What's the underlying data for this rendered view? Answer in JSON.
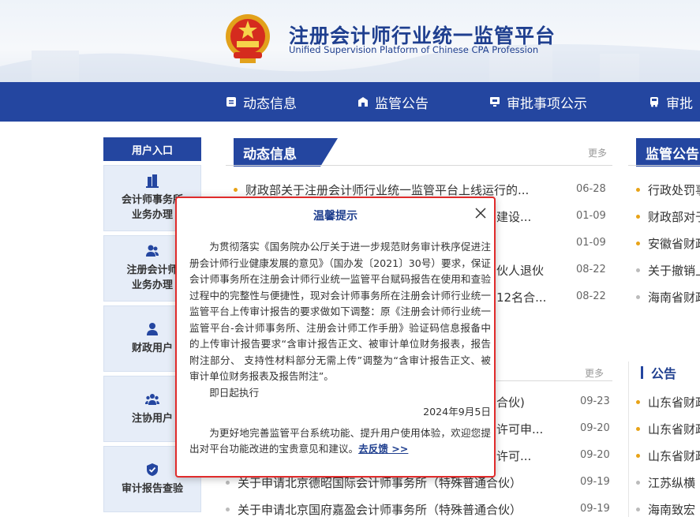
{
  "header": {
    "title_cn": "注册会计师行业统一监管平台",
    "title_en": "Unified Supervision Platform of Chinese CPA Profession"
  },
  "nav": {
    "items": [
      {
        "label": "动态信息",
        "icon": "document-icon"
      },
      {
        "label": "监管公告",
        "icon": "building-icon"
      },
      {
        "label": "审批事项公示",
        "icon": "monitor-icon"
      },
      {
        "label": "审批",
        "icon": "bus-icon"
      }
    ]
  },
  "sidebar": {
    "title": "用户入口",
    "items": [
      {
        "label": "会计师事务所\n业务办理",
        "icon": "building-icon"
      },
      {
        "label": "注册会计师\n业务办理",
        "icon": "users-icon"
      },
      {
        "label": "财政用户",
        "icon": "user-icon"
      },
      {
        "label": "注协用户",
        "icon": "group-icon"
      },
      {
        "label": "审计报告查验",
        "icon": "shield-check-icon"
      }
    ]
  },
  "news": {
    "title": "动态信息",
    "more": "更多",
    "rows": [
      {
        "text": "财政部关于注册会计师行业统一监管平台上线运行的...",
        "date": "06-28"
      },
      {
        "text": "建设...",
        "date": "01-09"
      },
      {
        "text": "",
        "date": "01-09"
      },
      {
        "text": "伙人退伙",
        "date": "08-22"
      },
      {
        "text": "12名合...",
        "date": "08-22"
      }
    ]
  },
  "approval": {
    "more": "更多",
    "rows": [
      {
        "text": "合伙)",
        "date": "09-23"
      },
      {
        "text": "许可申...",
        "date": "09-20"
      },
      {
        "text": "许可...",
        "date": "09-20"
      },
      {
        "text": "关于申请北京德昭国际会计师事务所（特殊普通合伙）",
        "date": "09-19"
      },
      {
        "text": "关于申请北京国府嘉盈会计师事务所（特殊普通合伙）",
        "date": "09-19"
      }
    ]
  },
  "supervision": {
    "title": "监管公告",
    "rows": [
      {
        "text": "行政处罚事"
      },
      {
        "text": "财政部对于"
      },
      {
        "text": "安徽省财政"
      },
      {
        "text": "关于撤销上"
      },
      {
        "text": "海南省财政"
      }
    ],
    "sub_title": "公告",
    "sub_rows": [
      {
        "text": "山东省财政"
      },
      {
        "text": "山东省财政"
      },
      {
        "text": "山东省财政"
      },
      {
        "text": "江苏纵横"
      },
      {
        "text": "海南致宏"
      }
    ]
  },
  "modal": {
    "title": "温馨提示",
    "paragraph1": "为贯彻落实《国务院办公厅关于进一步规范财务审计秩序促进注册会计师行业健康发展的意见》（国办发〔2021〕30号）要求，保证会计师事务所在注册会计师行业统一监管平台赋码报告在使用和查验过程中的完整性与便捷性，现对会计师事务所在注册会计师行业统一监管平台上传审计报告的要求做如下调整：原《注册会计师行业统一监管平台-会计师事务所、注册会计师工作手册》验证码信息报备中的上传审计报告要求“含审计报告正文、被审计单位财务报表，报告附注部分、 支持性材料部分无需上传”调整为“含审计报告正文、被审计单位财务报表及报告附注”。",
    "paragraph2": "即日起执行",
    "date": "2024年9月5日",
    "footer_text": "为更好地完善监管平台系统功能、提升用户使用体验，欢迎您提出对平台功能改进的宝贵意见和建议。",
    "feedback_link": "去反馈 >>",
    "close_icon": "close-icon"
  },
  "colors": {
    "brand_blue": "#2446a0",
    "accent_orange": "#e8a317",
    "modal_border": "#e02b2b"
  }
}
